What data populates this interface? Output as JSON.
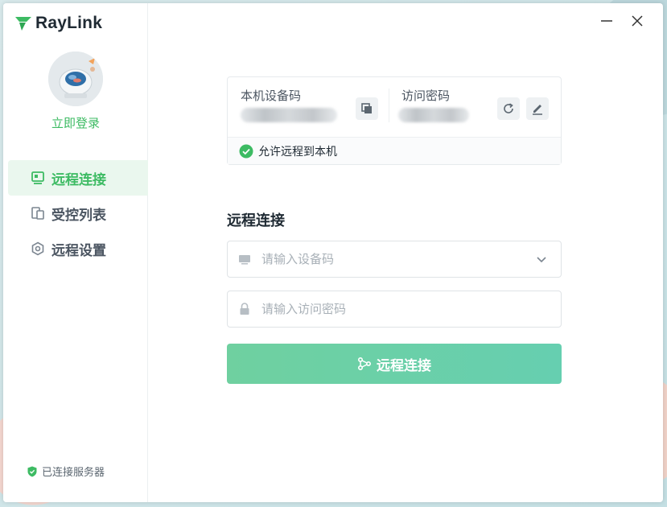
{
  "app": {
    "name": "RayLink"
  },
  "colors": {
    "accent": "#3dbb63",
    "button": "#6fd0a0"
  },
  "sidebar": {
    "login_label": "立即登录",
    "items": [
      {
        "label": "远程连接",
        "icon": "monitor-icon",
        "active": true
      },
      {
        "label": "受控列表",
        "icon": "devices-icon",
        "active": false
      },
      {
        "label": "远程设置",
        "icon": "hexagon-settings-icon",
        "active": false
      }
    ],
    "server_status": "已连接服务器"
  },
  "device_info": {
    "device_code_label": "本机设备码",
    "access_password_label": "访问密码",
    "allow_remote_label": "允许远程到本机"
  },
  "connect": {
    "title": "远程连接",
    "device_code_placeholder": "请输入设备码",
    "password_placeholder": "请输入访问密码",
    "button_label": "远程连接"
  }
}
